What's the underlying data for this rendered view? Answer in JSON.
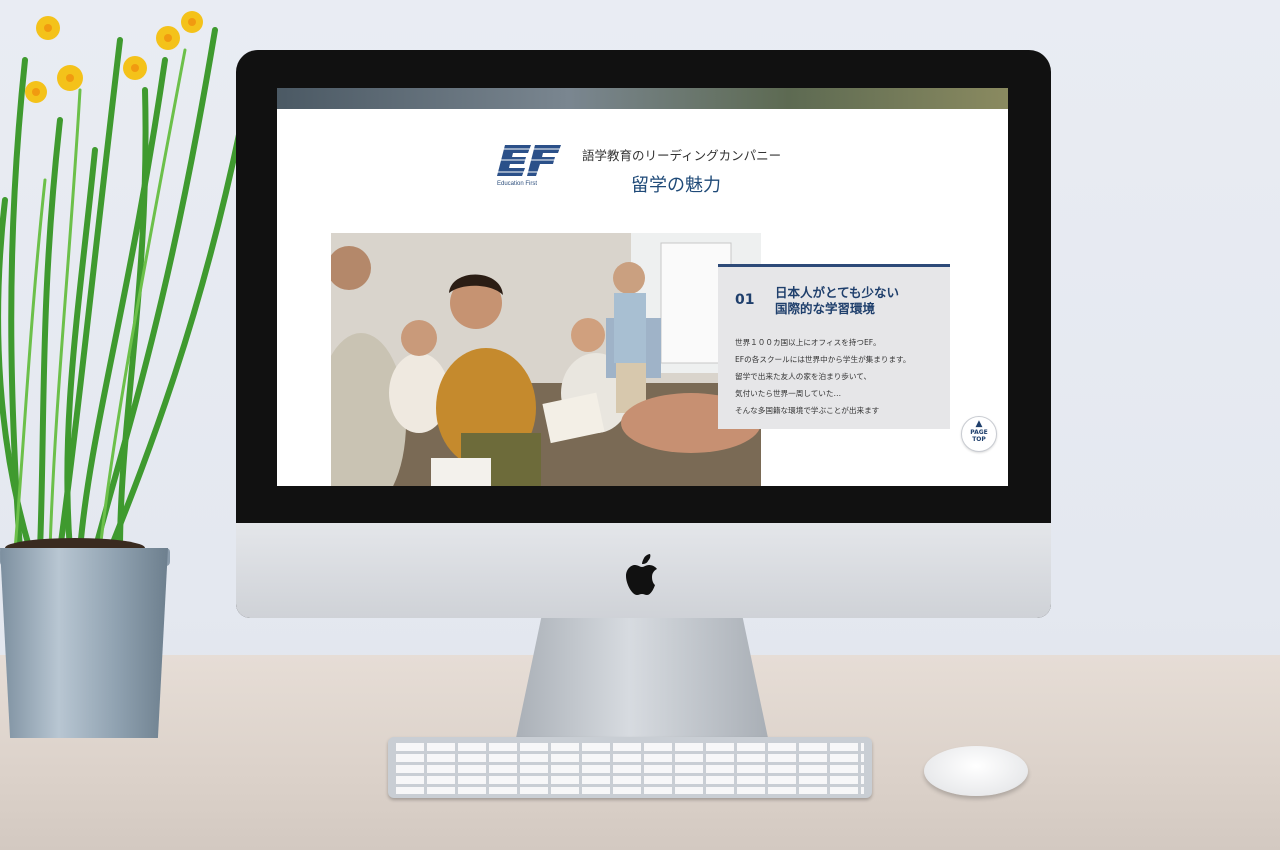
{
  "scene": {
    "background": "#e7eaf1",
    "desk_color": "#ddd3cb"
  },
  "page": {
    "brand": {
      "logo_text": "EF",
      "logo_subtext": "Education First",
      "tagline": "語学教育のリーディングカンパニー",
      "title": "留学の魅力",
      "brand_color": "#1f4a78"
    },
    "feature": {
      "number": "01",
      "title_line1": "日本人がとても少ない",
      "title_line2": "国際的な学習環境",
      "body_lines": [
        "世界１００カ国以上にオフィスを持つEF。",
        "EFの各スクールには世界中から学生が集まります。",
        "留学で出来た友人の家を泊まり歩いて、",
        "気付いたら世界一周していた…",
        "そんな多国籍な環境で学ぶことが出来ます"
      ],
      "accent_color": "#2d4a78"
    },
    "page_top": {
      "label_line1": "PAGE",
      "label_line2": "TOP",
      "icon": "chevron-up-icon"
    }
  }
}
